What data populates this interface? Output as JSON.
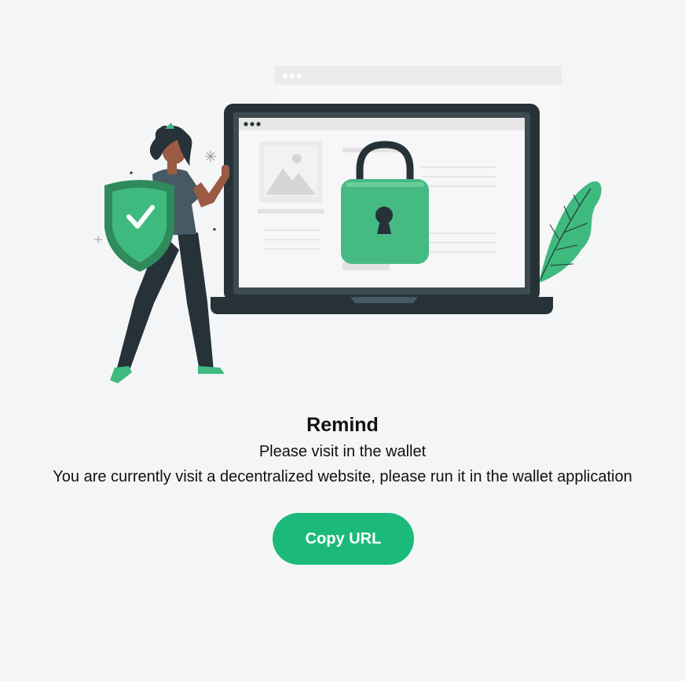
{
  "dialog": {
    "title": "Remind",
    "subtitle": "Please visit in the wallet",
    "message": "You are currently visit a decentralized website, please run it in the wallet application",
    "copy_button_label": "Copy URL"
  },
  "colors": {
    "accent": "#1bba7a",
    "background": "#f4f5f7",
    "dark": "#263238"
  },
  "illustration": {
    "icons": [
      "browser-window-icon",
      "laptop-icon",
      "padlock-icon",
      "shield-check-icon",
      "person-illustration",
      "leaf-plant-icon"
    ]
  }
}
